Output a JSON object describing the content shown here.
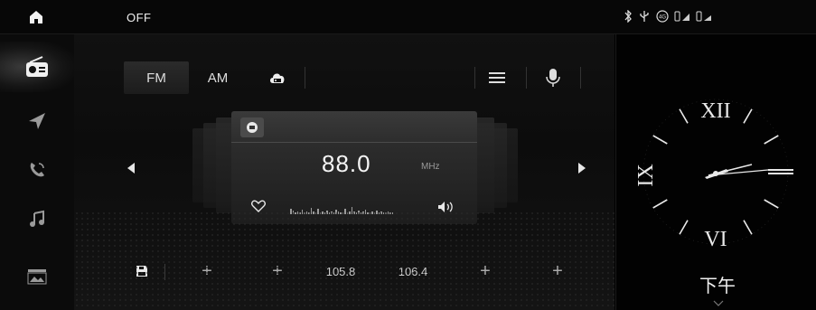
{
  "statusbar": {
    "home_icon": "home-icon",
    "radio_state": "OFF",
    "status_icons": [
      "bluetooth-icon",
      "usb-icon",
      "4g-icon",
      "signal-icon",
      "signal-icon-2"
    ]
  },
  "sidebar": {
    "items": [
      {
        "name": "radio",
        "icon": "radio-icon",
        "active": true
      },
      {
        "name": "navigation",
        "icon": "navigation-icon",
        "active": false
      },
      {
        "name": "phone",
        "icon": "phone-icon",
        "active": false
      },
      {
        "name": "music",
        "icon": "music-icon",
        "active": false
      },
      {
        "name": "gallery",
        "icon": "gallery-icon",
        "active": false
      }
    ]
  },
  "tabs": {
    "fm_label": "FM",
    "am_label": "AM",
    "cloud_icon": "cloud-radio-icon",
    "menu_icon": "menu-icon",
    "voice_icon": "voice-icon"
  },
  "station": {
    "frequency": "88.0",
    "unit": "MHz",
    "badge_icon": "radio-badge-icon",
    "favorite_icon": "heart-icon",
    "volume_icon": "speaker-icon"
  },
  "presets": {
    "save_icon": "save-icon",
    "slot_1": "+",
    "slot_2": "+",
    "slot_3": "105.8",
    "slot_4": "106.4",
    "slot_5": "+",
    "slot_6": "+"
  },
  "clock": {
    "period": "下午",
    "expand_icon": "chevron-down-icon"
  }
}
